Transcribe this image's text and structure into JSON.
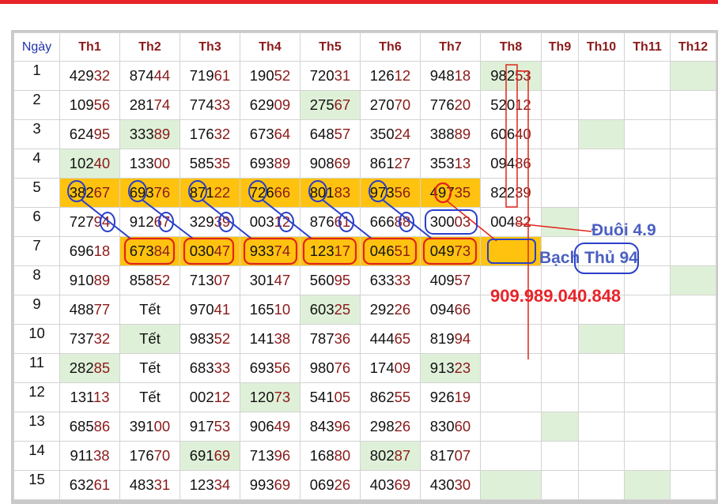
{
  "headers": [
    "Ngày",
    "Th1",
    "Th2",
    "Th3",
    "Th4",
    "Th5",
    "Th6",
    "Th7",
    "Th8",
    "Th9",
    "Th10",
    "Th11",
    "Th12"
  ],
  "rows": [
    {
      "day": "1",
      "cells": [
        "42932",
        "87444",
        "71961",
        "19052",
        "72031",
        "12612",
        "94818",
        "98253",
        "",
        "",
        "",
        ""
      ]
    },
    {
      "day": "2",
      "cells": [
        "10956",
        "28174",
        "77433",
        "62909",
        "27567",
        "27070",
        "77620",
        "52012",
        "",
        "",
        "",
        ""
      ]
    },
    {
      "day": "3",
      "cells": [
        "62495",
        "33389",
        "17632",
        "67364",
        "64857",
        "35024",
        "38889",
        "60640",
        "",
        "",
        "",
        ""
      ]
    },
    {
      "day": "4",
      "cells": [
        "10240",
        "13300",
        "58535",
        "69389",
        "90869",
        "86127",
        "35313",
        "09486",
        "",
        "",
        "",
        ""
      ]
    },
    {
      "day": "5",
      "cells": [
        "38267",
        "69376",
        "87122",
        "72666",
        "80183",
        "97356",
        "49735",
        "82239",
        "",
        "",
        "",
        ""
      ]
    },
    {
      "day": "6",
      "cells": [
        "72794",
        "91267",
        "32939",
        "00312",
        "87661",
        "66688",
        "30003",
        "00482",
        "",
        "",
        "",
        ""
      ]
    },
    {
      "day": "7",
      "cells": [
        "69618",
        "67384",
        "03047",
        "93374",
        "12317",
        "04651",
        "04973",
        "",
        "",
        "",
        "",
        ""
      ]
    },
    {
      "day": "8",
      "cells": [
        "91089",
        "85852",
        "71307",
        "30147",
        "56095",
        "63333",
        "40957",
        "",
        "",
        "",
        "",
        ""
      ]
    },
    {
      "day": "9",
      "cells": [
        "48877",
        "Tết",
        "97041",
        "16510",
        "60325",
        "29226",
        "09466",
        "",
        "",
        "",
        "",
        ""
      ]
    },
    {
      "day": "10",
      "cells": [
        "73732",
        "Tết",
        "98352",
        "14138",
        "78736",
        "44465",
        "81994",
        "",
        "",
        "",
        "",
        ""
      ]
    },
    {
      "day": "11",
      "cells": [
        "28285",
        "Tết",
        "68333",
        "69356",
        "98076",
        "17409",
        "91323",
        "",
        "",
        "",
        "",
        ""
      ]
    },
    {
      "day": "12",
      "cells": [
        "13113",
        "Tết",
        "00212",
        "12073",
        "54105",
        "86255",
        "92619",
        "",
        "",
        "",
        "",
        ""
      ]
    },
    {
      "day": "13",
      "cells": [
        "68586",
        "39100",
        "91753",
        "90649",
        "84396",
        "29826",
        "83060",
        "",
        "",
        "",
        "",
        ""
      ]
    },
    {
      "day": "14",
      "cells": [
        "91138",
        "17670",
        "69169",
        "71396",
        "16880",
        "80287",
        "81707",
        "",
        "",
        "",
        "",
        ""
      ]
    },
    {
      "day": "15",
      "cells": [
        "63261",
        "48331",
        "12334",
        "99369",
        "06926",
        "40369",
        "43030",
        "",
        "",
        "",
        "",
        ""
      ]
    }
  ],
  "annotations": {
    "duoi": "Đuôi 4.9",
    "bach_thu": "Bạch Thủ 94",
    "phone": "909.989.040.848"
  },
  "colors": {
    "highlight_orange": "#ffc30f",
    "highlight_green": "#dff0d8",
    "tail_red": "#8b1a1a",
    "day_blue": "#2233aa",
    "circle_blue": "#2a3fc9",
    "circle_red": "#e0241c"
  }
}
